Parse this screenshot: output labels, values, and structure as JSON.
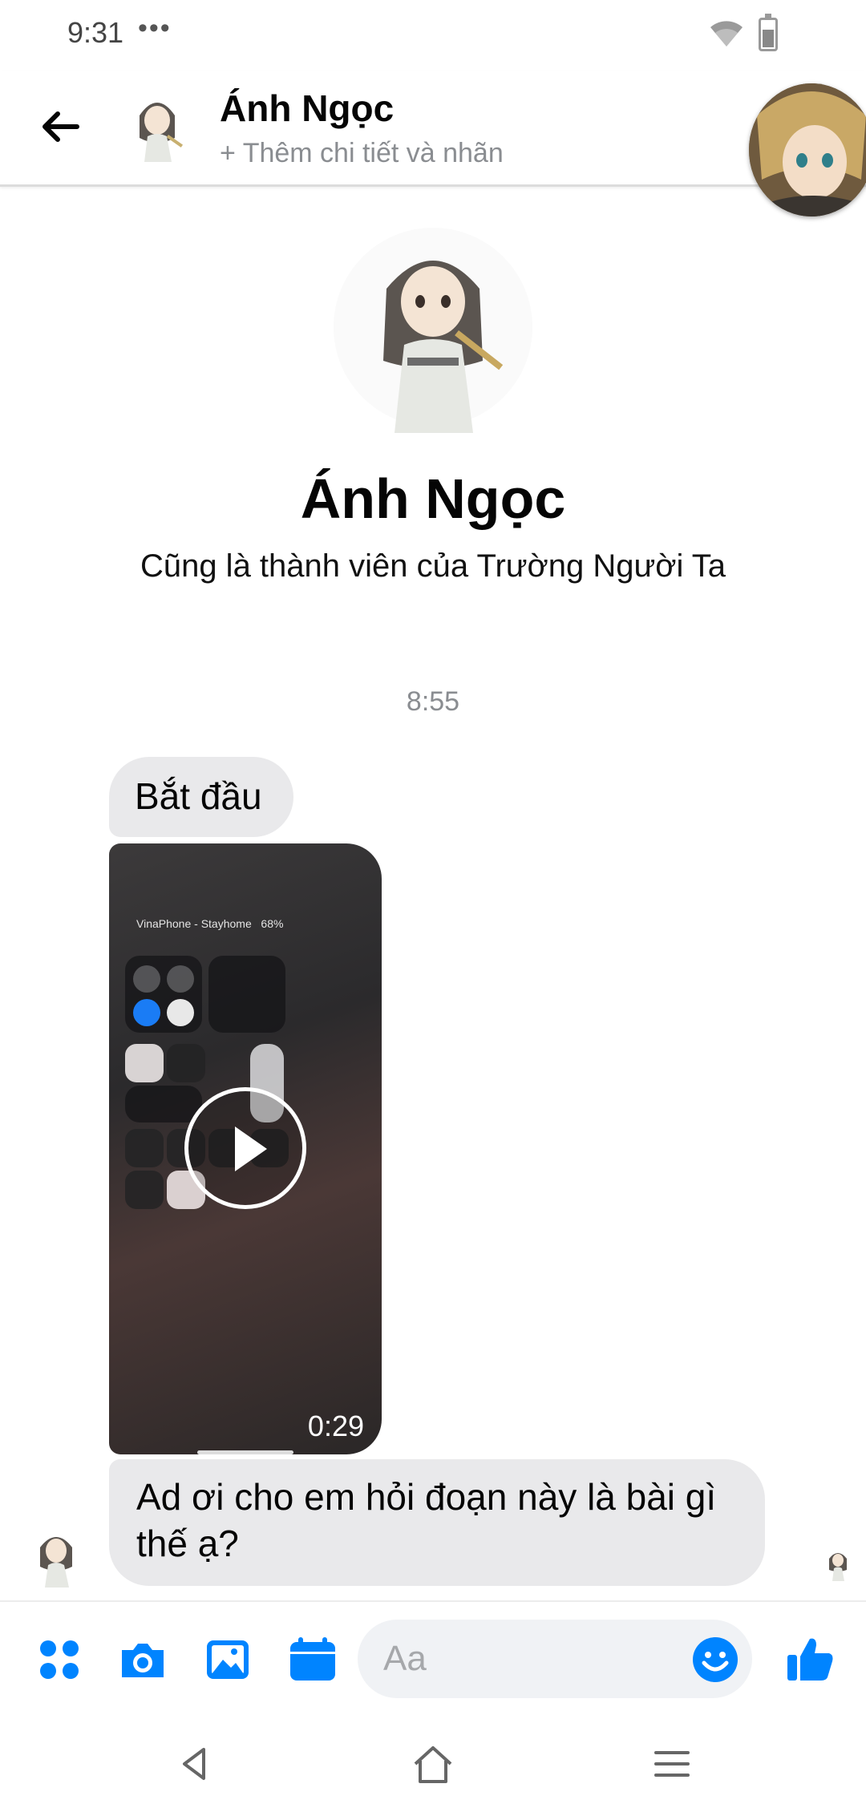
{
  "status_bar": {
    "time": "9:31",
    "dots": "•••"
  },
  "header": {
    "contact_name": "Ánh Ngọc",
    "subtitle": "+ Thêm chi tiết và nhãn"
  },
  "profile": {
    "name": "Ánh Ngọc",
    "info": "Cũng là thành viên của Trường Người Ta"
  },
  "conversation": {
    "timestamp": "8:55",
    "messages": [
      {
        "type": "text",
        "text": "Bắt đầu"
      },
      {
        "type": "video",
        "duration": "0:29",
        "preview_status_text": "VinaPhone - Stayhome",
        "preview_battery": "68%"
      },
      {
        "type": "text",
        "text": "Ad ơi cho em hỏi đoạn này là bài gì thế ạ?"
      }
    ]
  },
  "composer": {
    "placeholder": "Aa",
    "icons": [
      "apps-icon",
      "camera-icon",
      "gallery-icon",
      "calendar-icon",
      "emoji-icon",
      "like-icon"
    ]
  },
  "navigation": {
    "icons": [
      "back-triangle-icon",
      "home-icon",
      "menu-icon"
    ]
  },
  "colors": {
    "accent": "#0084ff",
    "bubble": "#e9e9eb",
    "secondary_text": "#8a8d91"
  }
}
